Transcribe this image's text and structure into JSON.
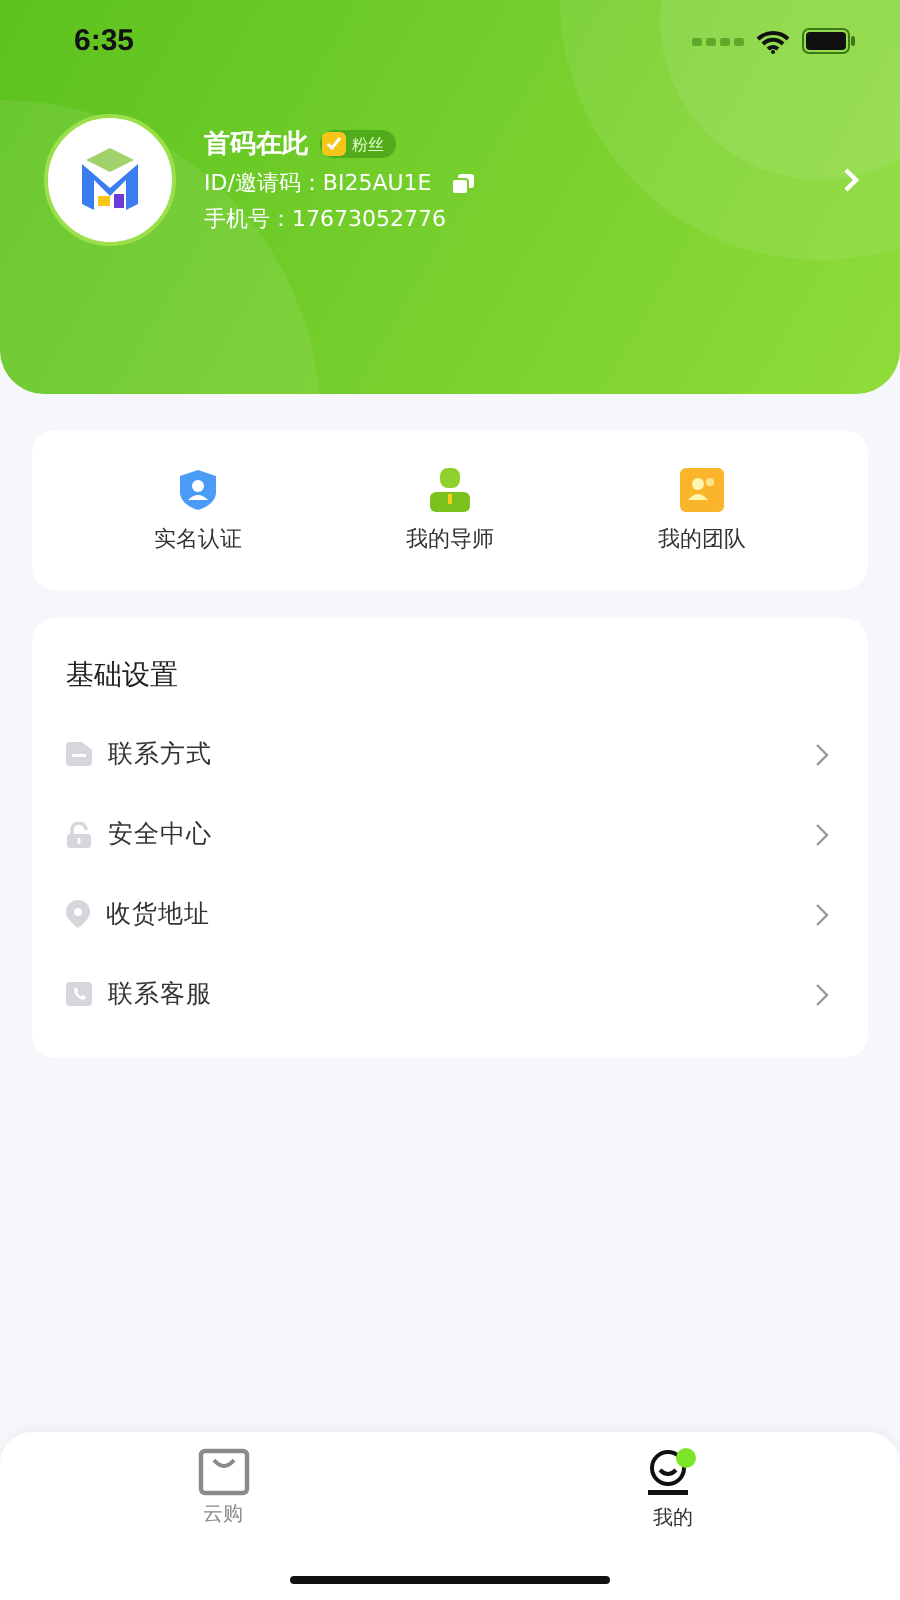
{
  "status_bar": {
    "time": "6:35"
  },
  "profile": {
    "name": "首码在此",
    "badge": "粉丝",
    "id_line": "ID/邀请码：BI25AU1E",
    "phone_line": "手机号：17673052776"
  },
  "quick_actions": [
    {
      "label": "实名认证",
      "kind": "shield"
    },
    {
      "label": "我的导师",
      "kind": "mentor"
    },
    {
      "label": "我的团队",
      "kind": "team"
    }
  ],
  "settings": {
    "title": "基础设置",
    "items": [
      {
        "label": "联系方式",
        "kind": "contact"
      },
      {
        "label": "安全中心",
        "kind": "lock"
      },
      {
        "label": "收货地址",
        "kind": "pin"
      },
      {
        "label": "联系客服",
        "kind": "phone"
      }
    ]
  },
  "tab_bar": [
    {
      "label": "云购",
      "kind": "bag",
      "selected": false
    },
    {
      "label": "我的",
      "kind": "face",
      "selected": true
    }
  ]
}
